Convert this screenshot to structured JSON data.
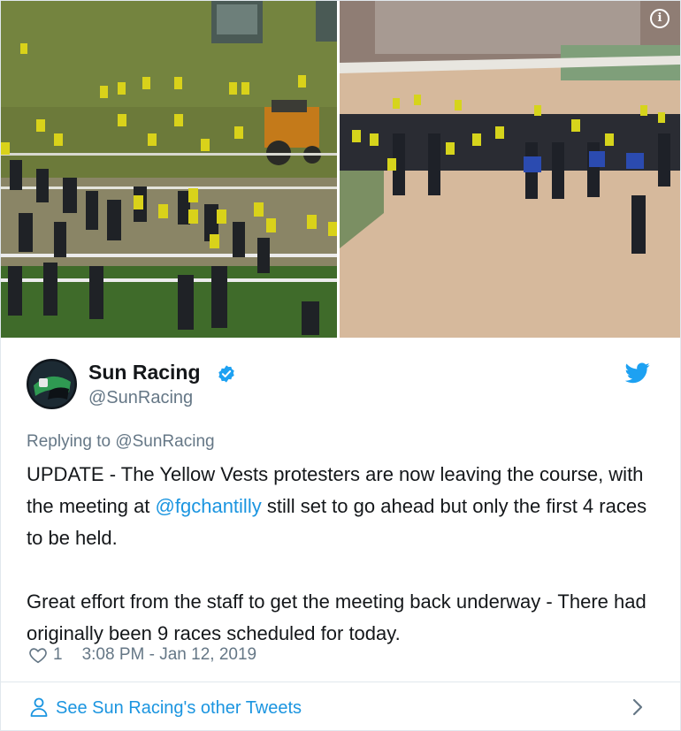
{
  "tweet": {
    "author": {
      "name": "Sun Racing",
      "handle": "@SunRacing",
      "avatar_icon": "sun-racing-logo",
      "verified_icon": "verified-badge-icon"
    },
    "replying_to": "Replying to @SunRacing",
    "text": {
      "para1_part1": "UPDATE - The Yellow Vests protesters are now leaving the course, with the meeting at ",
      "mention": "@fgchantilly",
      "para1_part2": " still set to go ahead but only the first 4 races to be held.",
      "para2": "Great effort from the staff to get the meeting back underway - There had originally been 9 races scheduled for today."
    },
    "likes": "1",
    "timestamp": "3:08 PM - Jan 12, 2019",
    "footer_link": "See Sun Racing's other Tweets",
    "icons": [
      "info-icon",
      "twitter-bird-icon",
      "heart-icon",
      "user-icon",
      "chevron-right-icon"
    ]
  },
  "colors": {
    "link_blue": "#1b95e0",
    "twitter_blue": "#1da1f2",
    "muted_gray": "#657786",
    "text_dark": "#14171a",
    "border": "#e1e8ed"
  }
}
